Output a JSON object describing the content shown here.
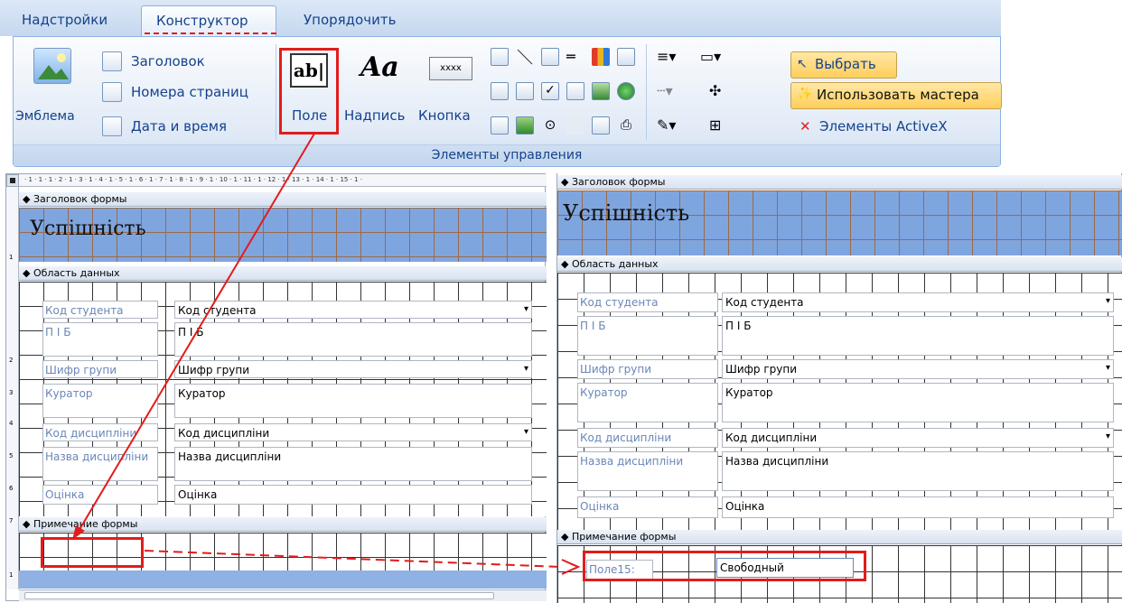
{
  "ribbon": {
    "tabs": [
      "Надстройки",
      "Конструктор",
      "Упорядочить"
    ],
    "logo_label": "Эмблема",
    "header_items": [
      "Заголовок",
      "Номера страниц",
      "Дата и время"
    ],
    "field_label": "Поле",
    "label_label": "Надпись",
    "button_label": "Кнопка",
    "button_icon_text": "xxxx",
    "label_icon_text": "Aa",
    "field_icon_text": "ab|",
    "select_label": "Выбрать",
    "wizard_label": "Использовать мастера",
    "activex_label": "Элементы ActiveX",
    "group_label": "Элементы управления"
  },
  "left_form": {
    "ruler_text": "· 1 · 1 · 1 · 2 · 1 · 3 · 1 · 4 · 1 · 5 · 1 · 6 · 1 · 7 · 1 · 8 · 1 · 9 · 1 · 10 · 1 · 11 · 1 · 12 · 1 · 13 · 1 · 14 · 1 · 15 · 1 ·",
    "header_section": "Заголовок формы",
    "title": "Успішність",
    "data_section": "Область данных",
    "footer_section": "Примечание формы",
    "rows": [
      {
        "label": "Код студента",
        "value": "Код студента",
        "dropdown": true
      },
      {
        "label": "П І Б",
        "value": "П І Б",
        "dropdown": false
      },
      {
        "label": "Шифр групи",
        "value": "Шифр групи",
        "dropdown": true
      },
      {
        "label": "Куратор",
        "value": "Куратор",
        "dropdown": false
      },
      {
        "label": "Код дисципліни",
        "value": "Код дисципліни",
        "dropdown": true
      },
      {
        "label": "Назва дисципліни",
        "value": "Назва дисципліни",
        "dropdown": false
      },
      {
        "label": "Оцінка",
        "value": "Оцінка",
        "dropdown": false
      }
    ],
    "vruler_marks": [
      "1",
      "2",
      "3",
      "4",
      "5",
      "6",
      "7",
      "1"
    ]
  },
  "right_form": {
    "header_section": "Заголовок формы",
    "title": "Успішність",
    "data_section": "Область данных",
    "footer_section": "Примечание формы",
    "rows": [
      {
        "label": "Код студента",
        "value": "Код студента",
        "dropdown": true
      },
      {
        "label": "П І Б",
        "value": "П І Б",
        "dropdown": false
      },
      {
        "label": "Шифр групи",
        "value": "Шифр групи",
        "dropdown": true
      },
      {
        "label": "Куратор",
        "value": "Куратор",
        "dropdown": false
      },
      {
        "label": "Код дисципліни",
        "value": "Код дисципліни",
        "dropdown": true
      },
      {
        "label": "Назва дисципліни",
        "value": "Назва дисципліни",
        "dropdown": false
      },
      {
        "label": "Оцінка",
        "value": "Оцінка",
        "dropdown": false
      }
    ],
    "new_field_label": "Поле15:",
    "new_field_value": "Свободный"
  },
  "colors": {
    "accent_red": "#e21c1c",
    "ribbon_text": "#15428b",
    "header_fill": "#7fa5df"
  }
}
